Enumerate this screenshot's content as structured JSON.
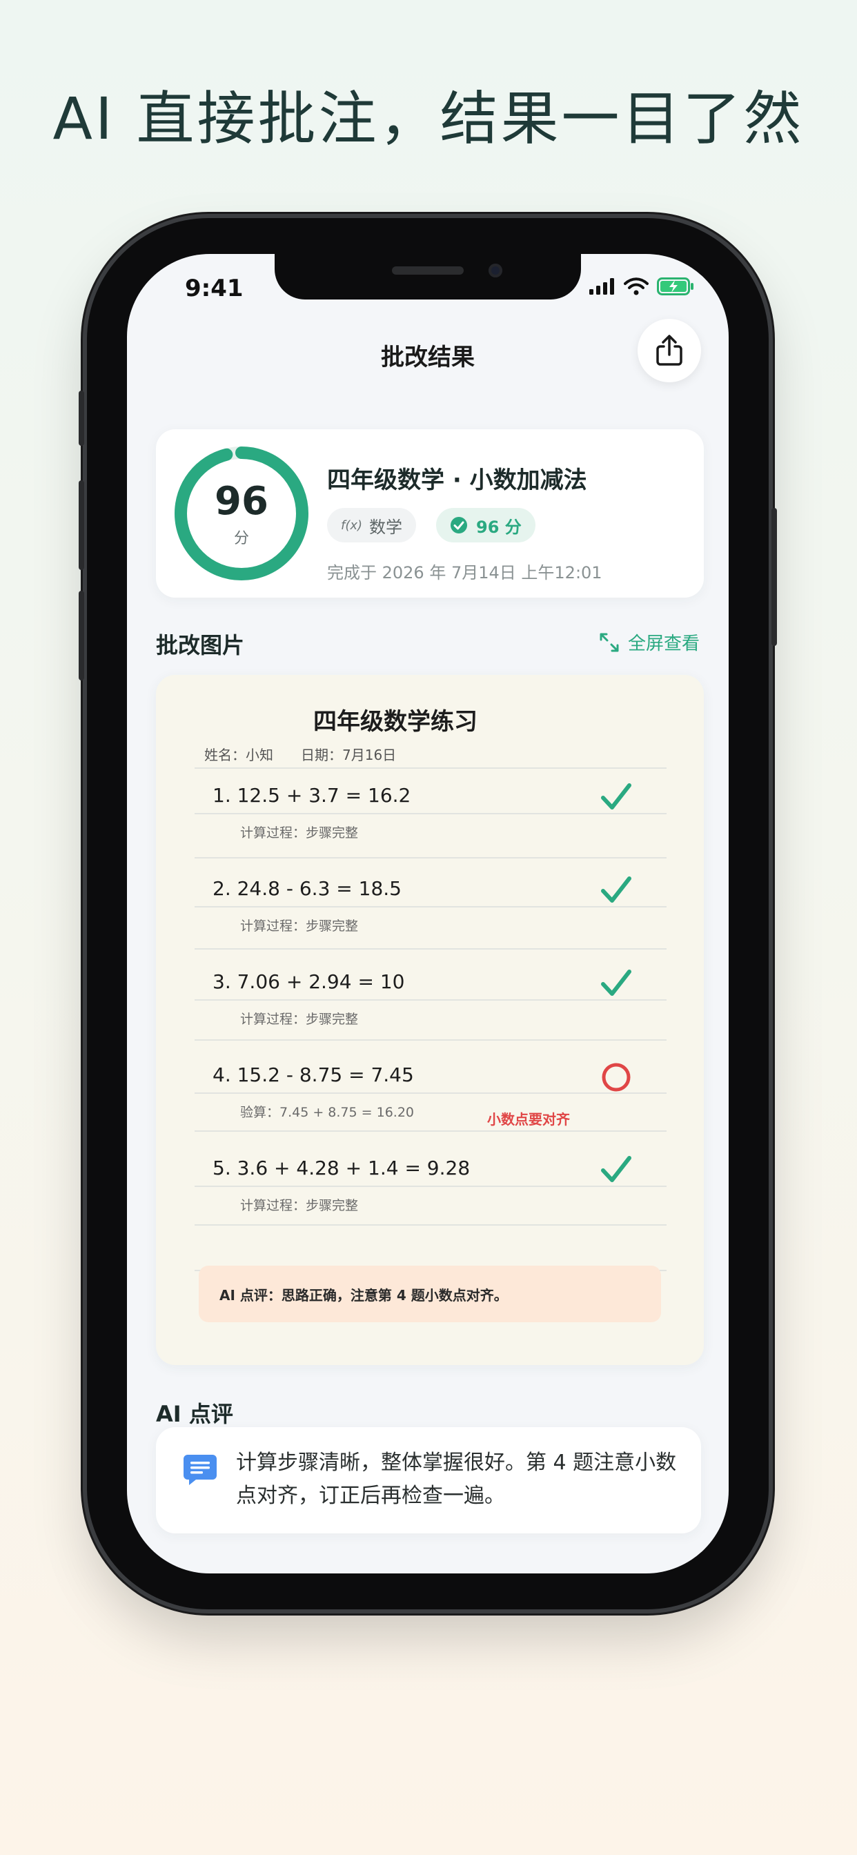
{
  "headline": "AI 直接批注，结果一目了然",
  "status_bar": {
    "time": "9:41"
  },
  "nav": {
    "title": "批改结果"
  },
  "score_card": {
    "score": "96",
    "score_unit": "分",
    "score_fraction": 0.96,
    "title": "四年级数学 · 小数加减法",
    "subject_chip": "数学",
    "subject_icon_text": "f(x)",
    "score_chip": "96 分",
    "completed_time": "完成于 2026 年 7月14日 上午12:01"
  },
  "graded_section": {
    "title": "批改图片",
    "fullscreen_label": "全屏查看"
  },
  "worksheet": {
    "title": "四年级数学练习",
    "meta": "姓名：小知　　日期：7月16日",
    "problems": [
      {
        "text": "1.  12.5 + 3.7 = 16.2",
        "note": "计算过程：步骤完整",
        "result": "correct"
      },
      {
        "text": "2.  24.8 - 6.3 = 18.5",
        "note": "计算过程：步骤完整",
        "result": "correct"
      },
      {
        "text": "3.  7.06 + 2.94 = 10",
        "note": "计算过程：步骤完整",
        "result": "correct"
      },
      {
        "text": "4.  15.2 - 8.75 = 7.45",
        "note": "验算：7.45 + 8.75 = 16.20",
        "result": "wrong"
      },
      {
        "text": "5.  3.6 + 4.28 + 1.4 = 9.28",
        "note": "计算过程：步骤完整",
        "result": "correct"
      }
    ],
    "wrong_annotation": "小数点要对齐",
    "ai_box": "AI 点评：思路正确，注意第 4 题小数点对齐。"
  },
  "ai_comment": {
    "title": "AI 点评",
    "text": "计算步骤清晰，整体掌握很好。第 4 题注意小数点对齐，订正后再检查一遍。"
  },
  "colors": {
    "accent": "#2aa981",
    "error": "#e04646",
    "ai_box": "#fde8d8",
    "comment_icon": "#4a8ff0"
  }
}
